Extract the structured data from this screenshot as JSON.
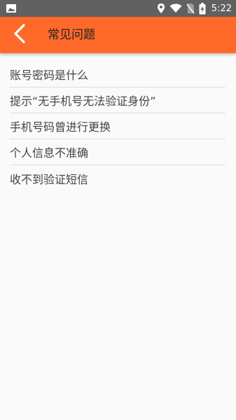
{
  "status_bar": {
    "time": "5:22",
    "icons": [
      "image-icon",
      "location-icon",
      "wifi-icon",
      "no-sim-icon",
      "battery-charging-icon"
    ]
  },
  "app_bar": {
    "title": "常见问题",
    "back_icon": "chevron-left-icon",
    "color": "#ff6a2a"
  },
  "faq": {
    "items": [
      {
        "label": "账号密码是什么"
      },
      {
        "label": "提示“无手机号无法验证身份”"
      },
      {
        "label": "手机号码曾进行更换"
      },
      {
        "label": "个人信息不准确"
      },
      {
        "label": "收不到验证短信"
      }
    ]
  }
}
